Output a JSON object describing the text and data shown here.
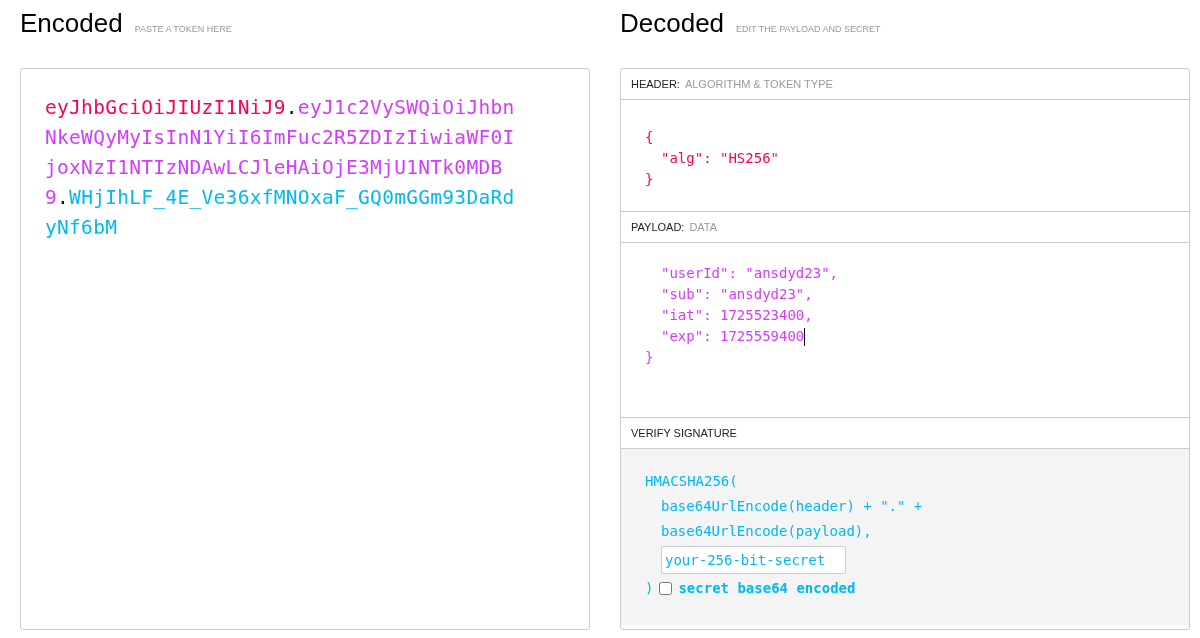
{
  "encoded": {
    "title": "Encoded",
    "subtitle": "PASTE A TOKEN HERE",
    "token_parts": [
      {
        "kind": "header",
        "text": "eyJhbGciOiJIUzI1NiJ9"
      },
      {
        "kind": "dot",
        "text": "."
      },
      {
        "kind": "payload",
        "text": "eyJ1c2VySWQiOiJhbnNkeWQyMyIsInN1YiI6ImFuc2R5ZDIzIiwiaWF0IjoxNzI1NTIzNDAwLCJleHAiOjE3MjU1NTk0MDB9"
      },
      {
        "kind": "dot",
        "text": "."
      },
      {
        "kind": "signature",
        "text": "WHjIhLF_4E_Ve36xfMNOxaF_GQ0mGGm93DaRdyNf6bM"
      }
    ]
  },
  "decoded": {
    "title": "Decoded",
    "subtitle": "EDIT THE PAYLOAD AND SECRET",
    "header": {
      "label": "HEADER:",
      "sublabel": "ALGORITHM & TOKEN TYPE",
      "lines": [
        {
          "kind": "brace",
          "text": "{"
        },
        {
          "kind": "entry",
          "text": "\"alg\": \"HS256\""
        },
        {
          "kind": "brace",
          "text": "}"
        }
      ]
    },
    "payload": {
      "label": "PAYLOAD:",
      "sublabel": "DATA",
      "lines": [
        {
          "kind": "entry",
          "text": "\"userId\": \"ansdyd23\","
        },
        {
          "kind": "entry",
          "text": "\"sub\": \"ansdyd23\","
        },
        {
          "kind": "entry",
          "text": "\"iat\": 1725523400,"
        },
        {
          "kind": "entry",
          "text": "\"exp\": 1725559400",
          "cursor": true
        },
        {
          "kind": "brace",
          "text": "}"
        }
      ]
    },
    "verify": {
      "label": "VERIFY SIGNATURE",
      "function": "HMACSHA256(",
      "args": [
        "base64UrlEncode(header) + \".\" +",
        "base64UrlEncode(payload),"
      ],
      "secret": {
        "placeholder": "your-256-bit-secret"
      },
      "close": ")",
      "base64": {
        "label": "secret base64 encoded",
        "checked": false
      }
    }
  }
}
